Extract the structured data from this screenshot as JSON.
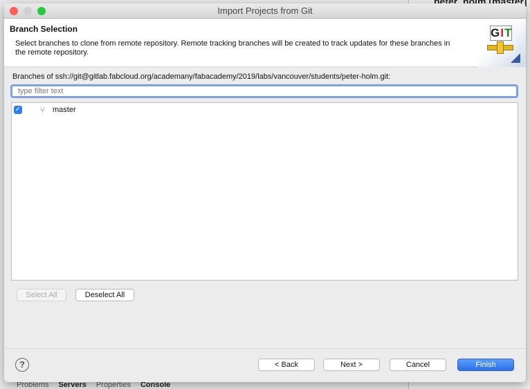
{
  "background": {
    "partial_title": "peter_holm [master]",
    "bottom_tabs": [
      "Problems",
      "Servers",
      "Properties",
      "Console"
    ]
  },
  "window": {
    "title": "Import Projects from Git"
  },
  "header": {
    "title": "Branch Selection",
    "description": "Select branches to clone from remote repository. Remote tracking branches will be created to track updates for these branches in the remote repository.",
    "logo_text": "GIT"
  },
  "branches_label": "Branches of ssh://git@gitlab.fabcloud.org/academany/fabacademy/2019/labs/vancouver/students/peter-holm.git:",
  "filter": {
    "value": "",
    "placeholder": "type filter text"
  },
  "branches": [
    {
      "name": "master",
      "checked": true,
      "icon": "branch-icon"
    }
  ],
  "buttons": {
    "select_all": "Select All",
    "deselect_all": "Deselect All",
    "back": "< Back",
    "next": "Next >",
    "cancel": "Cancel",
    "finish": "Finish",
    "help": "?"
  },
  "colors": {
    "accent": "#2f7cf6",
    "close": "#fc5f57",
    "minimize": "#cfcfcf",
    "zoom": "#28c840"
  }
}
